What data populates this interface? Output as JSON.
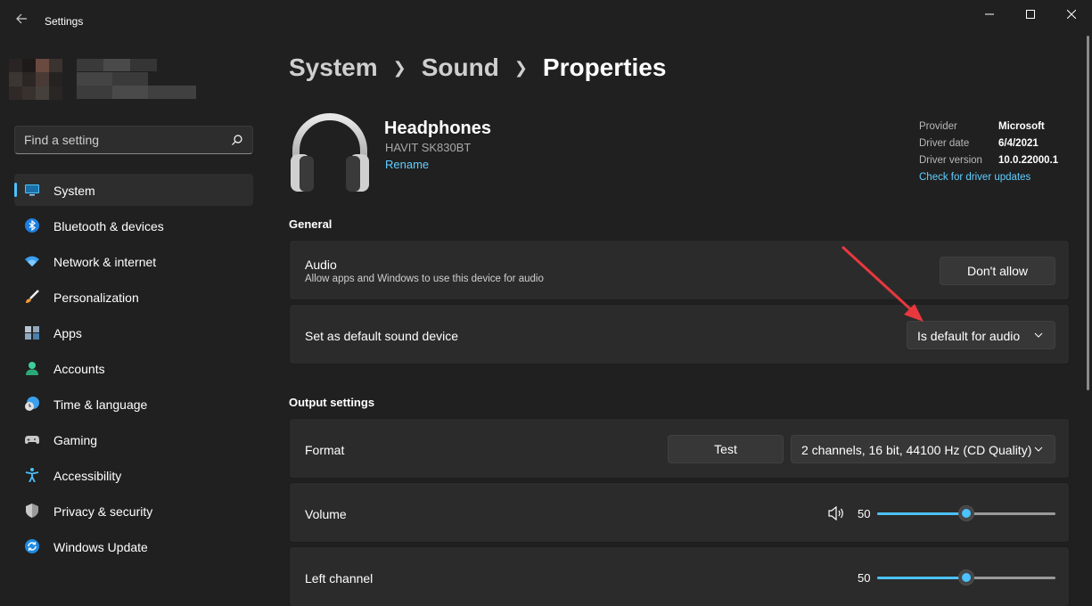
{
  "window": {
    "title": "Settings",
    "back_icon": "back-arrow-icon"
  },
  "search": {
    "placeholder": "Find a setting",
    "icon": "search-icon"
  },
  "sidebar": {
    "items": [
      {
        "label": "System",
        "icon": "system-display-icon",
        "active": true
      },
      {
        "label": "Bluetooth & devices",
        "icon": "bluetooth-icon"
      },
      {
        "label": "Network & internet",
        "icon": "wifi-icon"
      },
      {
        "label": "Personalization",
        "icon": "brush-icon"
      },
      {
        "label": "Apps",
        "icon": "apps-icon"
      },
      {
        "label": "Accounts",
        "icon": "person-icon"
      },
      {
        "label": "Time & language",
        "icon": "globe-clock-icon"
      },
      {
        "label": "Gaming",
        "icon": "gamepad-icon"
      },
      {
        "label": "Accessibility",
        "icon": "accessibility-icon"
      },
      {
        "label": "Privacy & security",
        "icon": "shield-icon"
      },
      {
        "label": "Windows Update",
        "icon": "update-icon"
      }
    ]
  },
  "breadcrumb": {
    "items": [
      "System",
      "Sound",
      "Properties"
    ]
  },
  "device": {
    "name": "Headphones",
    "model": "HAVIT SK830BT",
    "rename_label": "Rename",
    "icon": "headphones-icon"
  },
  "driver": {
    "rows": [
      {
        "key": "Provider",
        "value": "Microsoft"
      },
      {
        "key": "Driver date",
        "value": "6/4/2021"
      },
      {
        "key": "Driver version",
        "value": "10.0.22000.1"
      }
    ],
    "update_link": "Check for driver updates"
  },
  "general": {
    "heading": "General",
    "audio": {
      "title": "Audio",
      "subtitle": "Allow apps and Windows to use this device for audio",
      "button": "Don't allow"
    },
    "default_device": {
      "title": "Set as default sound device",
      "selected": "Is default for audio"
    }
  },
  "output": {
    "heading": "Output settings",
    "format": {
      "title": "Format",
      "test_button": "Test",
      "selected": "2 channels, 16 bit, 44100 Hz (CD Quality)"
    },
    "volume": {
      "title": "Volume",
      "value": "50",
      "percent": 50,
      "icon": "speaker-icon"
    },
    "left_channel": {
      "title": "Left channel",
      "value": "50",
      "percent": 50
    }
  },
  "colors": {
    "accent": "#4cc2ff",
    "link": "#60cdff",
    "annotation_arrow": "#e8383d"
  }
}
